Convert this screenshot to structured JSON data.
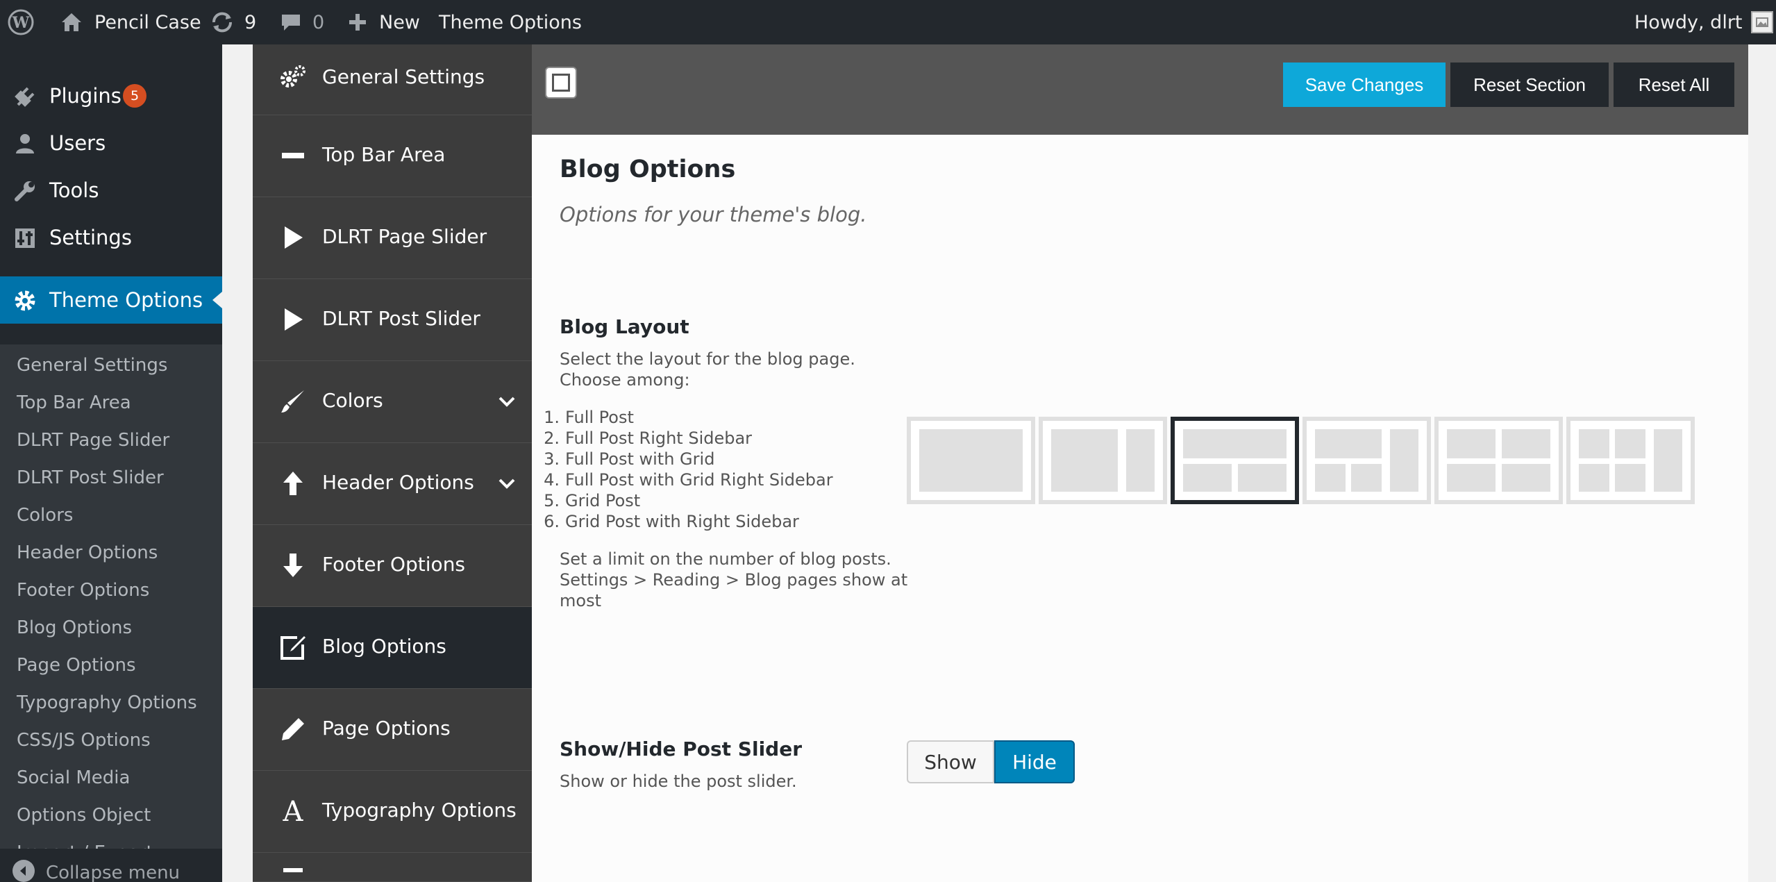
{
  "adminbar": {
    "wp_logo_icon": "wordpress-icon",
    "site_name": "Pencil Case",
    "updates_count": "9",
    "comments_count": "0",
    "new_label": "New",
    "theme_options_label": "Theme Options",
    "howdy": "Howdy, dlrt"
  },
  "sidebar": {
    "items": [
      {
        "label": "Plugins",
        "icon": "plugin-icon",
        "badge": "5"
      },
      {
        "label": "Users",
        "icon": "users-icon"
      },
      {
        "label": "Tools",
        "icon": "wrench-icon"
      },
      {
        "label": "Settings",
        "icon": "settings-icon"
      },
      {
        "label": "Theme Options",
        "icon": "gear-icon"
      }
    ],
    "submenu": [
      "General Settings",
      "Top Bar Area",
      "DLRT Page Slider",
      "DLRT Post Slider",
      "Colors",
      "Header Options",
      "Footer Options",
      "Blog Options",
      "Page Options",
      "Typography Options",
      "CSS/JS Options",
      "Social Media",
      "Options Object",
      "Import / Export"
    ],
    "collapse_label": "Collapse menu"
  },
  "redux_nav": [
    {
      "label": "General Settings",
      "icon": "gears-icon"
    },
    {
      "label": "Top Bar Area",
      "icon": "minus-icon"
    },
    {
      "label": "DLRT Page Slider",
      "icon": "play-icon"
    },
    {
      "label": "DLRT Post Slider",
      "icon": "play-icon"
    },
    {
      "label": "Colors",
      "icon": "brush-icon",
      "expandable": true
    },
    {
      "label": "Header Options",
      "icon": "arrow-up-icon",
      "expandable": true
    },
    {
      "label": "Footer Options",
      "icon": "arrow-down-icon"
    },
    {
      "label": "Blog Options",
      "icon": "edit-icon",
      "active": true
    },
    {
      "label": "Page Options",
      "icon": "pencil-icon"
    },
    {
      "label": "Typography Options",
      "icon": "font-icon"
    }
  ],
  "header": {
    "save": "Save Changes",
    "reset_section": "Reset Section",
    "reset_all": "Reset All"
  },
  "section": {
    "title": "Blog Options",
    "description": "Options for your theme's blog."
  },
  "blog_layout": {
    "title": "Blog Layout",
    "subtitle_lines": [
      "Select the layout for the blog page.",
      "Choose among:"
    ],
    "options": [
      "Full Post",
      "Full Post Right Sidebar",
      "Full Post with Grid",
      "Full Post with Grid Right Sidebar",
      "Grid Post",
      "Grid Post with Right Sidebar"
    ],
    "note_lines": [
      "Set a limit on the number of blog posts.",
      "Settings > Reading > Blog pages show at",
      "most"
    ],
    "selected_index": 2
  },
  "post_slider": {
    "title": "Show/Hide Post Slider",
    "subtitle": "Show or hide the post slider.",
    "show_label": "Show",
    "hide_label": "Hide",
    "selected": "Hide"
  },
  "colors": {
    "adminbar_bg": "#23282d",
    "menu_active": "#0073aa",
    "save_button": "#0ea8d9",
    "toggle_active": "#0085ba",
    "badge": "#d54e21"
  }
}
